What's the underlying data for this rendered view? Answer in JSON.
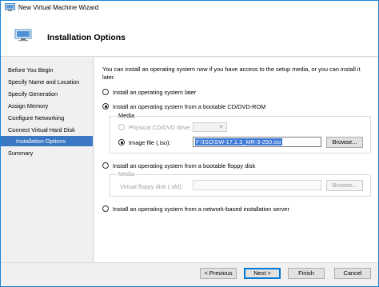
{
  "window": {
    "title": "New Virtual Machine Wizard",
    "icon": "hyperv-app-icon"
  },
  "header": {
    "title": "Installation Options",
    "icon": "monitor-icon"
  },
  "nav": {
    "items": [
      {
        "label": "Before You Begin"
      },
      {
        "label": "Specify Name and Location"
      },
      {
        "label": "Specify Generation"
      },
      {
        "label": "Assign Memory"
      },
      {
        "label": "Configure Networking"
      },
      {
        "label": "Connect Virtual Hard Disk"
      },
      {
        "label": "Installation Options",
        "active": true
      },
      {
        "label": "Summary"
      }
    ]
  },
  "main": {
    "intro": "You can install an operating system now if you have access to the setup media, or you can install it later.",
    "options": {
      "later": "Install an operating system later",
      "cdrom": "Install an operating system from a bootable CD/DVD-ROM",
      "floppy": "Install an operating system from a bootable floppy disk",
      "network": "Install an operating system from a network-based installation server"
    },
    "selected_option": "cdrom",
    "cd_media": {
      "group_label": "Media",
      "physical_label": "Physical CD/DVD drive:",
      "image_label": "Image file (.iso):",
      "image_value": "F:\\ISO\\SW-17.1.3_MR-3-250.iso",
      "browse_label": "Browse..."
    },
    "floppy_media": {
      "group_label": "Media",
      "vfd_label": "Virtual floppy disk (.vfd):",
      "vfd_value": "",
      "browse_label": "Browse..."
    }
  },
  "footer": {
    "previous": "< Previous",
    "next": "Next >",
    "finish": "Finish",
    "cancel": "Cancel"
  },
  "colors": {
    "accent": "#0078d7",
    "nav_active": "#3b78c4",
    "selection": "#3c78d8"
  }
}
